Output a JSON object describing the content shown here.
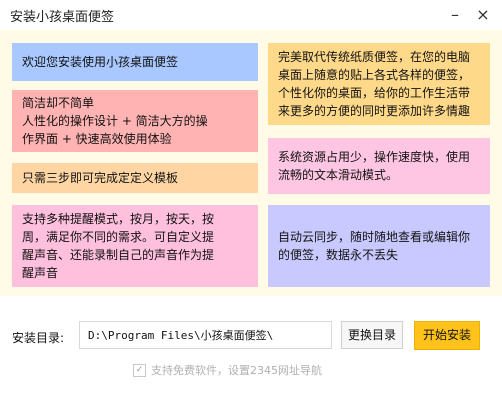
{
  "window": {
    "title": "安装小孩桌面便签",
    "minimize_glyph": "–",
    "close_glyph": "×"
  },
  "features": [
    {
      "id": "welcome",
      "color": "#a9c8ff",
      "lines": [
        "欢迎您安装使用小孩桌面便签"
      ]
    },
    {
      "id": "replace",
      "color": "#ffd98a",
      "lines": [
        "完美取代传统纸质便签，在您的电脑",
        "桌面上随意的贴上各式各样的便签，",
        "个性化你的桌面，给你的工作生活带",
        "来更多的方便的同时更添加许多情趣"
      ]
    },
    {
      "id": "simple",
      "color": "#ffb3b3",
      "lines": [
        "简洁却不简单",
        "人性化的操作设计 + 简洁大方的操",
        "作界面 + 快速高效使用体验"
      ]
    },
    {
      "id": "resource",
      "color": "#ffc6e4",
      "lines": [
        "系统资源占用少，操作速度快，使用",
        "流畅的文本滑动模式。"
      ]
    },
    {
      "id": "steps",
      "color": "#ffd6a3",
      "lines": [
        "只需三步即可完成定定义模板"
      ]
    },
    {
      "id": "reminder",
      "color": "#ffc0de",
      "lines": [
        "支持多种提醒模式，按月，按天，按",
        "周，满足你不同的需求。可自定义提",
        "醒声音、还能录制自己的声音作为提",
        "醒声音"
      ]
    },
    {
      "id": "sync",
      "color": "#c9c9ff",
      "lines": [
        "自动云同步，随时随地查看或编辑你",
        "的便签，数据永不丢失"
      ]
    }
  ],
  "install": {
    "label": "安装目录:",
    "path": "D:\\Program Files\\小孩桌面便签\\",
    "browse_label": "更换目录",
    "start_label": "开始安装"
  },
  "option": {
    "checkbox_label": "支持免费软件，设置2345网址导航",
    "checked": true,
    "check_glyph": "✓"
  }
}
